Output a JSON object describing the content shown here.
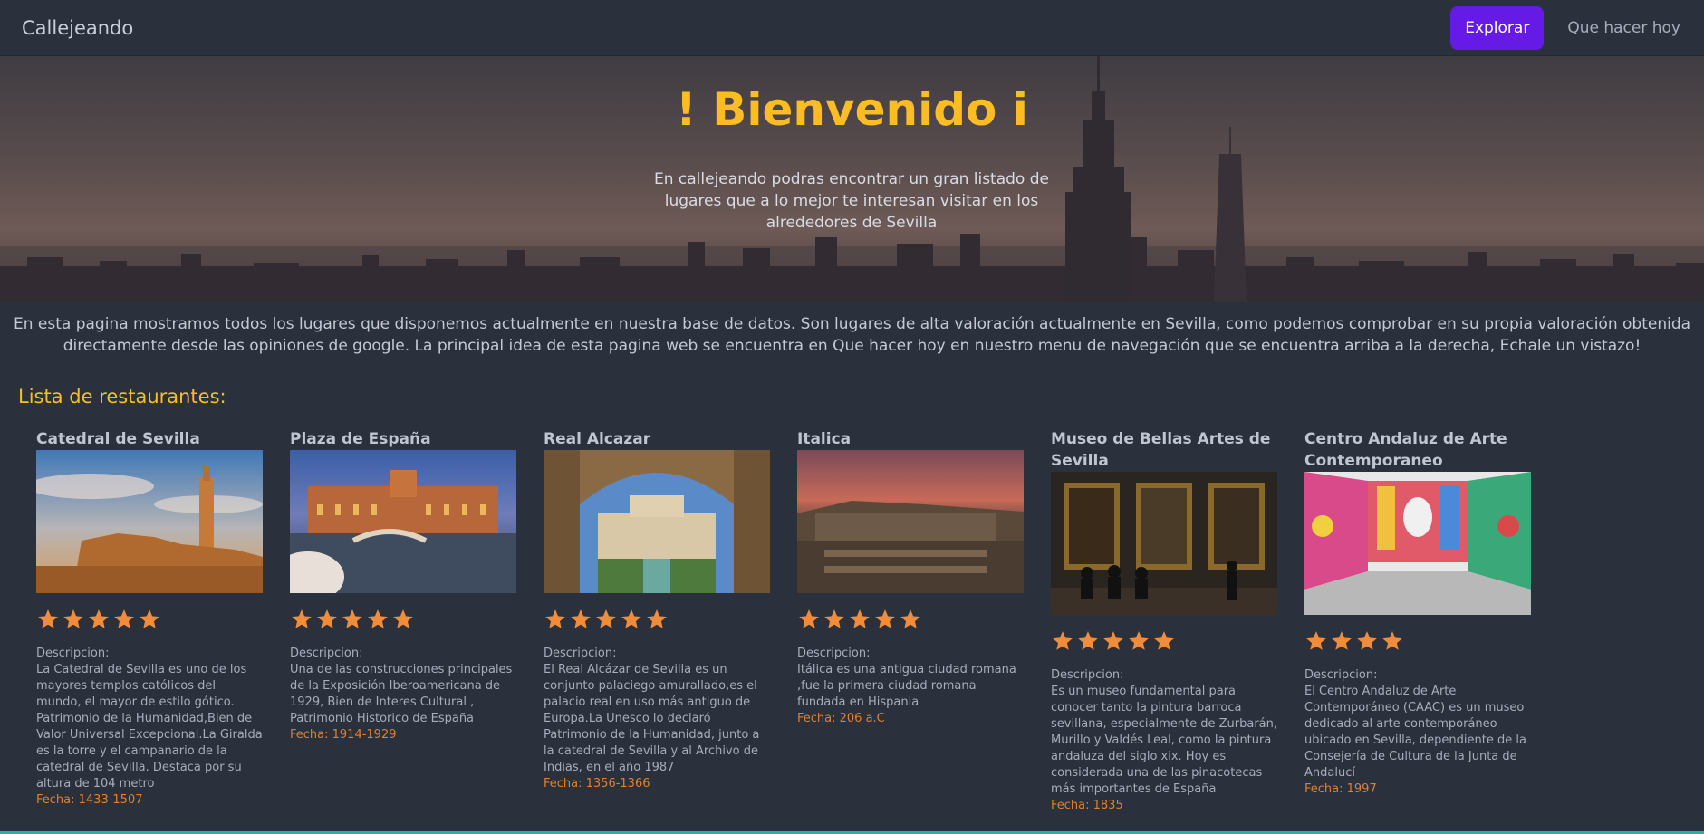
{
  "navbar": {
    "brand": "Callejeando",
    "explore_label": "Explorar",
    "link_label": "Que hacer hoy"
  },
  "hero": {
    "title": "! Bienvenido i",
    "text": "En callejeando podras encontrar un gran listado de lugares que a lo mejor te interesan visitar en los alrededores de Sevilla"
  },
  "intro": "En esta pagina mostramos todos los lugares que disponemos actualmente en nuestra base de datos. Son lugares de alta valoración actualmente en Sevilla, como podemos comprobar en su propia valoración obtenida directamente desde las opiniones de google. La principal idea de esta pagina web se encuentra en Que hacer hoy en nuestro menu de navegación que se encuentra arriba a la derecha, Echale un vistazo!",
  "section_title": "Lista de restaurantes:",
  "colors": {
    "accent": "#fbbd23",
    "primary": "#661ae6",
    "star": "#f08c3a",
    "fecha": "#e0802c"
  },
  "places": [
    {
      "title": "Catedral de Sevilla",
      "rating": 5,
      "desc_label": "Descripcion:",
      "description": "La Catedral de Sevilla es uno de los mayores templos católicos del mundo, el mayor de estilo gótico. Patrimonio de la Humanidad,Bien de Valor Universal Excepcional.La Giralda es la torre y el campanario de la catedral de Sevilla. Destaca por su altura de 104 metro",
      "fecha": "Fecha: 1433-1507",
      "image": "cathedral-photo"
    },
    {
      "title": "Plaza de España",
      "rating": 5,
      "desc_label": "Descripcion:",
      "description": "Una de las construcciones principales de la Exposición Iberoamericana de 1929, Bien de Interes Cultural , Patrimonio Historico de España",
      "fecha": "Fecha: 1914-1929",
      "image": "plaza-photo"
    },
    {
      "title": "Real Alcazar",
      "rating": 5,
      "desc_label": "Descripcion:",
      "description": "El Real Alcázar de Sevilla es un conjunto palaciego amurallado,es el palacio real en uso más antiguo de Europa.La Unesco lo declaró Patrimonio de la Humanidad, junto a la catedral de Sevilla y al Archivo de Indias, en el año 1987",
      "fecha": "Fecha: 1356-1366",
      "image": "alcazar-photo"
    },
    {
      "title": "Italica",
      "rating": 5,
      "desc_label": "Descripcion:",
      "description": "Itálica es una antigua ciudad romana ,fue la primera ciudad romana fundada en Hispania",
      "fecha": "Fecha: 206 a.C",
      "image": "italica-photo"
    },
    {
      "title": "Museo de Bellas Artes de Sevilla",
      "rating": 5,
      "desc_label": "Descripcion:",
      "description": "Es un museo fundamental para conocer tanto la pintura barroca sevillana, especialmente de Zurbarán, Murillo y Valdés Leal, como la pintura andaluza del siglo xix. Hoy es considerada una de las pinacotecas más importantes de España",
      "fecha": "Fecha: 1835",
      "image": "museum-photo"
    },
    {
      "title": "Centro Andaluz de Arte Contemporaneo",
      "rating": 4,
      "desc_label": "Descripcion:",
      "description": "El Centro Andaluz de Arte Contemporáneo (CAAC) es un museo dedicado al arte contemporáneo ubicado en Sevilla, dependiente de la Consejería de Cultura de la Junta de Andalucí",
      "fecha": "Fecha: 1997",
      "image": "caac-photo"
    }
  ]
}
